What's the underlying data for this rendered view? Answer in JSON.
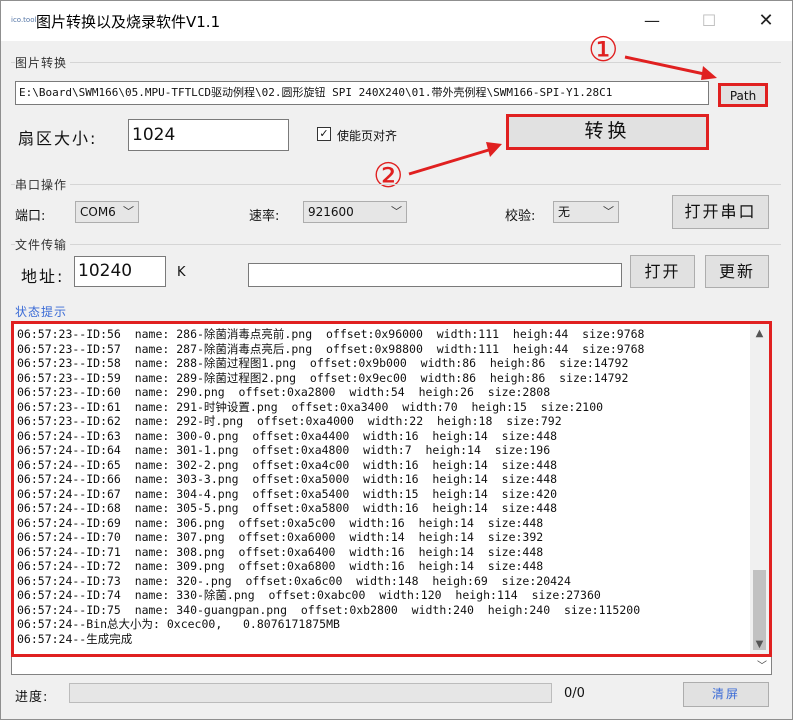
{
  "window": {
    "icon_text": "ico.tool",
    "title": "图片转换以及烧录软件V1.1",
    "min_glyph": "—",
    "max_glyph": "☐",
    "close_glyph": "✕"
  },
  "image_convert": {
    "group_label": "图片转换",
    "path_value": "E:\\Board\\SWM166\\05.MPU-TFTLCD驱动例程\\02.圆形旋钮 SPI 240X240\\01.带外壳例程\\SWM166-SPI-Y1.28C1",
    "path_button": "Path",
    "sector_label": "扇区大小:",
    "sector_value": "1024",
    "align_checkbox_label": "使能页对齐",
    "align_checked": true,
    "convert_button": "转换"
  },
  "annotations": {
    "step1": "①",
    "step2": "②",
    "color": "#e02020"
  },
  "serial": {
    "group_label": "串口操作",
    "port_label": "端口:",
    "port_value": "COM6",
    "baud_label": "速率:",
    "baud_value": "921600",
    "parity_label": "校验:",
    "parity_value": "无",
    "open_port_button": "打开串口"
  },
  "file_transfer": {
    "group_label": "文件传输",
    "address_label": "地址:",
    "address_value": "10240",
    "address_unit": "K",
    "file_value": "",
    "open_button": "打开",
    "update_button": "更新"
  },
  "status": {
    "label": "状态提示",
    "lines": [
      "06:57:23--ID:56  name: 286-除菌消毒点亮前.png  offset:0x96000  width:111  heigh:44  size:9768",
      "06:57:23--ID:57  name: 287-除菌消毒点亮后.png  offset:0x98800  width:111  heigh:44  size:9768",
      "06:57:23--ID:58  name: 288-除菌过程图1.png  offset:0x9b000  width:86  heigh:86  size:14792",
      "06:57:23--ID:59  name: 289-除菌过程图2.png  offset:0x9ec00  width:86  heigh:86  size:14792",
      "06:57:23--ID:60  name: 290.png  offset:0xa2800  width:54  heigh:26  size:2808",
      "06:57:23--ID:61  name: 291-时钟设置.png  offset:0xa3400  width:70  heigh:15  size:2100",
      "06:57:23--ID:62  name: 292-时.png  offset:0xa4000  width:22  heigh:18  size:792",
      "06:57:24--ID:63  name: 300-0.png  offset:0xa4400  width:16  heigh:14  size:448",
      "06:57:24--ID:64  name: 301-1.png  offset:0xa4800  width:7  heigh:14  size:196",
      "06:57:24--ID:65  name: 302-2.png  offset:0xa4c00  width:16  heigh:14  size:448",
      "06:57:24--ID:66  name: 303-3.png  offset:0xa5000  width:16  heigh:14  size:448",
      "06:57:24--ID:67  name: 304-4.png  offset:0xa5400  width:15  heigh:14  size:420",
      "06:57:24--ID:68  name: 305-5.png  offset:0xa5800  width:16  heigh:14  size:448",
      "06:57:24--ID:69  name: 306.png  offset:0xa5c00  width:16  heigh:14  size:448",
      "06:57:24--ID:70  name: 307.png  offset:0xa6000  width:14  heigh:14  size:392",
      "06:57:24--ID:71  name: 308.png  offset:0xa6400  width:16  heigh:14  size:448",
      "06:57:24--ID:72  name: 309.png  offset:0xa6800  width:16  heigh:14  size:448",
      "06:57:24--ID:73  name: 320-.png  offset:0xa6c00  width:148  heigh:69  size:20424",
      "06:57:24--ID:74  name: 330-除菌.png  offset:0xabc00  width:120  heigh:114  size:27360",
      "06:57:24--ID:75  name: 340-guangpan.png  offset:0xb2800  width:240  heigh:240  size:115200",
      "06:57:24--Bin总大小为: 0xcec00,   0.8076171875MB",
      "06:57:24--生成完成"
    ]
  },
  "footer": {
    "progress_label": "进度:",
    "progress_value": 0,
    "progress_text": "0/0",
    "clear_button": "清屏"
  }
}
